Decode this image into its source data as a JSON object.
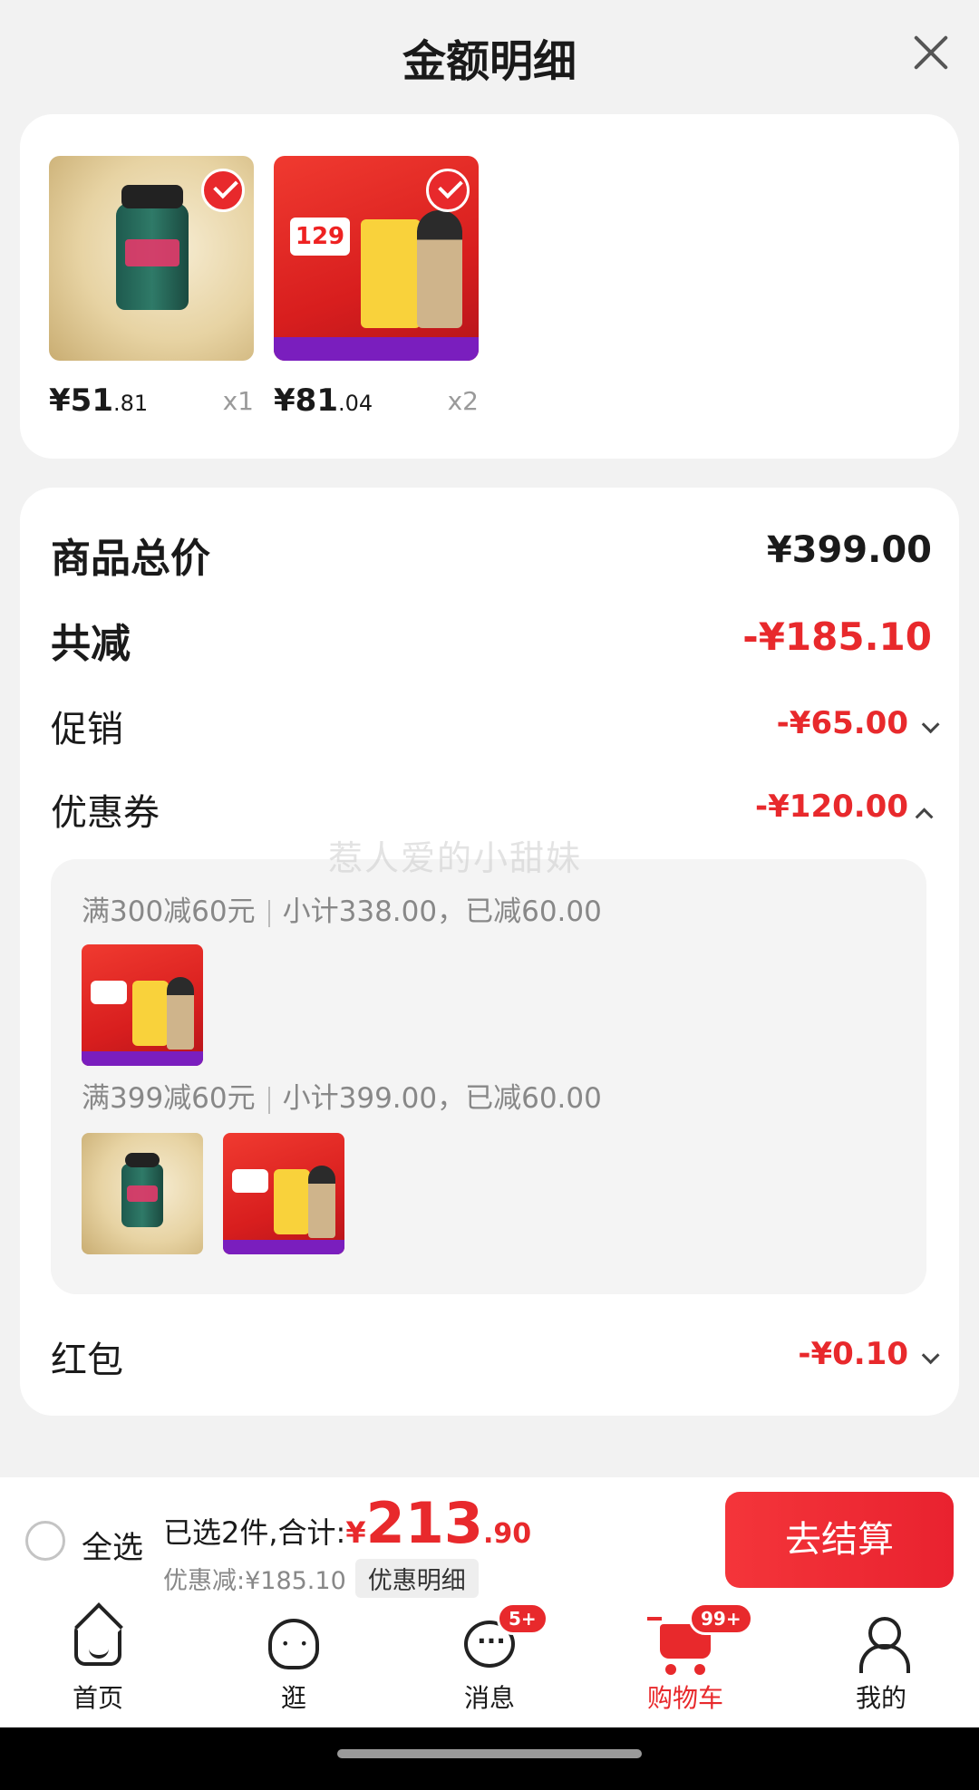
{
  "sheet": {
    "title": "金额明细"
  },
  "products": [
    {
      "price_int": "¥51",
      "price_dec": ".81",
      "qty": "x1"
    },
    {
      "price_int": "¥81",
      "price_dec": ".04",
      "qty": "x2"
    }
  ],
  "details": {
    "total_label": "商品总价",
    "total_value": "¥399.00",
    "reduce_label": "共减",
    "reduce_value": "-¥185.10",
    "promo_label": "促销",
    "promo_value": "-¥65.00",
    "coupon_label": "优惠券",
    "coupon_value": "-¥120.00",
    "redpacket_label": "红包",
    "redpacket_value": "-¥0.10"
  },
  "coupons": [
    {
      "rule": "满300减60元",
      "subtotal": "小计338.00，已减60.00"
    },
    {
      "rule": "满399减60元",
      "subtotal": "小计399.00，已减60.00"
    }
  ],
  "watermark": "惹人爱的小甜妹",
  "checkout": {
    "select_all": "全选",
    "selected_text": "已选2件,合计:",
    "total_yen": "¥",
    "total_int": "213",
    "total_dec": ".90",
    "saved_text": "优惠减:¥185.10",
    "detail_link": "优惠明细",
    "button": "去结算"
  },
  "tabs": [
    {
      "label": "首页",
      "icon": "home-icon"
    },
    {
      "label": "逛",
      "icon": "browse-icon"
    },
    {
      "label": "消息",
      "icon": "message-icon",
      "badge": "5+"
    },
    {
      "label": "购物车",
      "icon": "cart-icon",
      "badge": "99+",
      "active": true
    },
    {
      "label": "我的",
      "icon": "profile-icon"
    }
  ],
  "colors": {
    "accent": "#e8292c",
    "text": "#1a1a1a",
    "muted": "#888888",
    "background": "#f2f2f2"
  }
}
